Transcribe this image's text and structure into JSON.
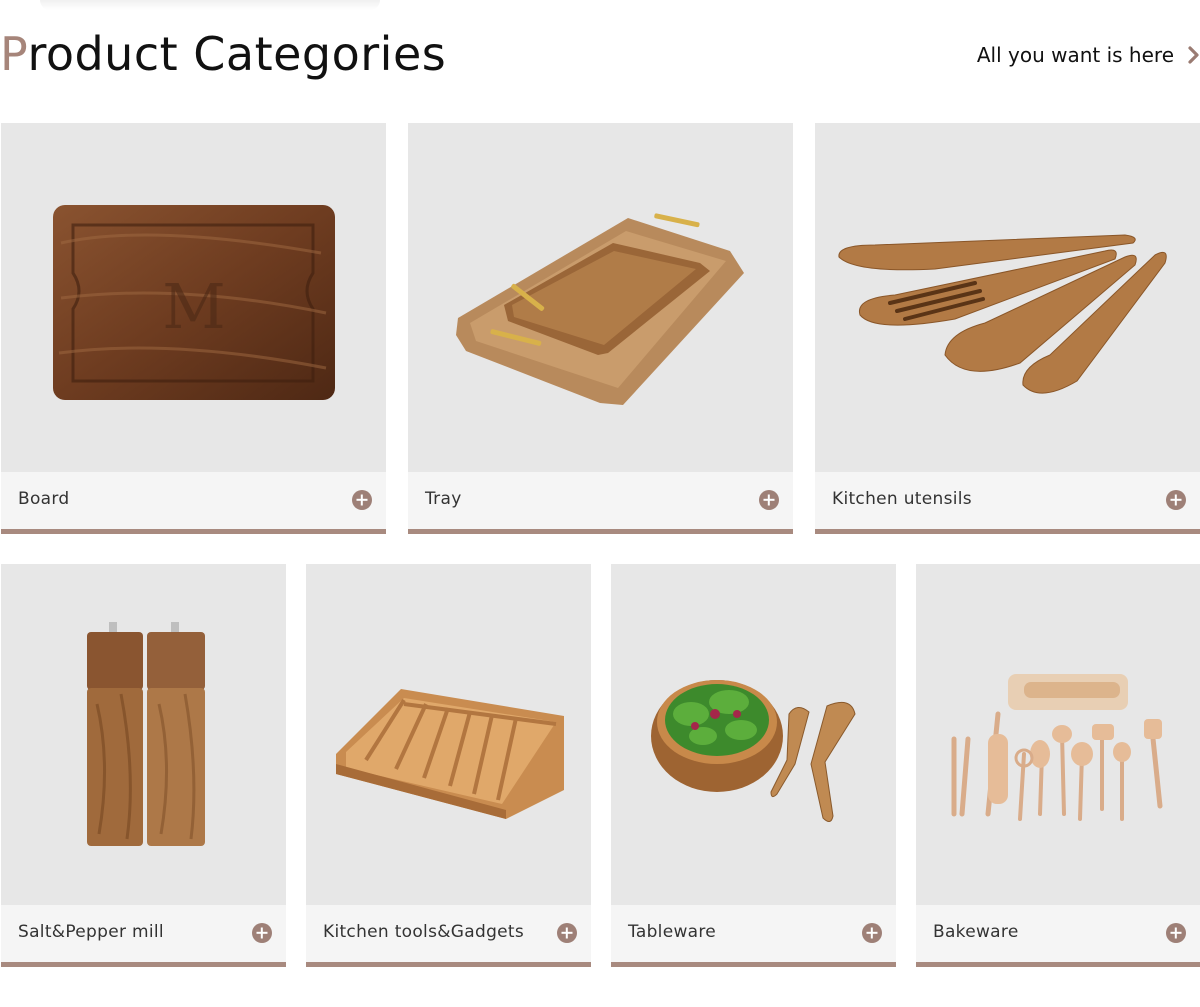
{
  "header": {
    "title_first": "P",
    "title_rest": "roduct Categories",
    "more_link": "All you want is here"
  },
  "categories": [
    {
      "label": "Board",
      "image": "walnut-cutting-board-monogram"
    },
    {
      "label": "Tray",
      "image": "wooden-serving-trays-with-gold-handles"
    },
    {
      "label": "Kitchen utensils",
      "image": "wooden-spatula-set"
    },
    {
      "label": "Salt&Pepper mill",
      "image": "wooden-salt-pepper-grinders"
    },
    {
      "label": "Kitchen tools&Gadgets",
      "image": "bamboo-cutlery-drawer-organizer"
    },
    {
      "label": "Tableware",
      "image": "olive-wood-salad-bowl-with-servers"
    },
    {
      "label": "Bakeware",
      "image": "kids-wooden-baking-tool-set"
    }
  ],
  "colors": {
    "accent": "#a88a7f",
    "icon": "#9e8077",
    "card_bg": "#e7e7e7",
    "label_bg": "#f5f5f5"
  },
  "icons": {
    "more": "chevron-right-icon",
    "expand": "plus-circle-icon"
  }
}
